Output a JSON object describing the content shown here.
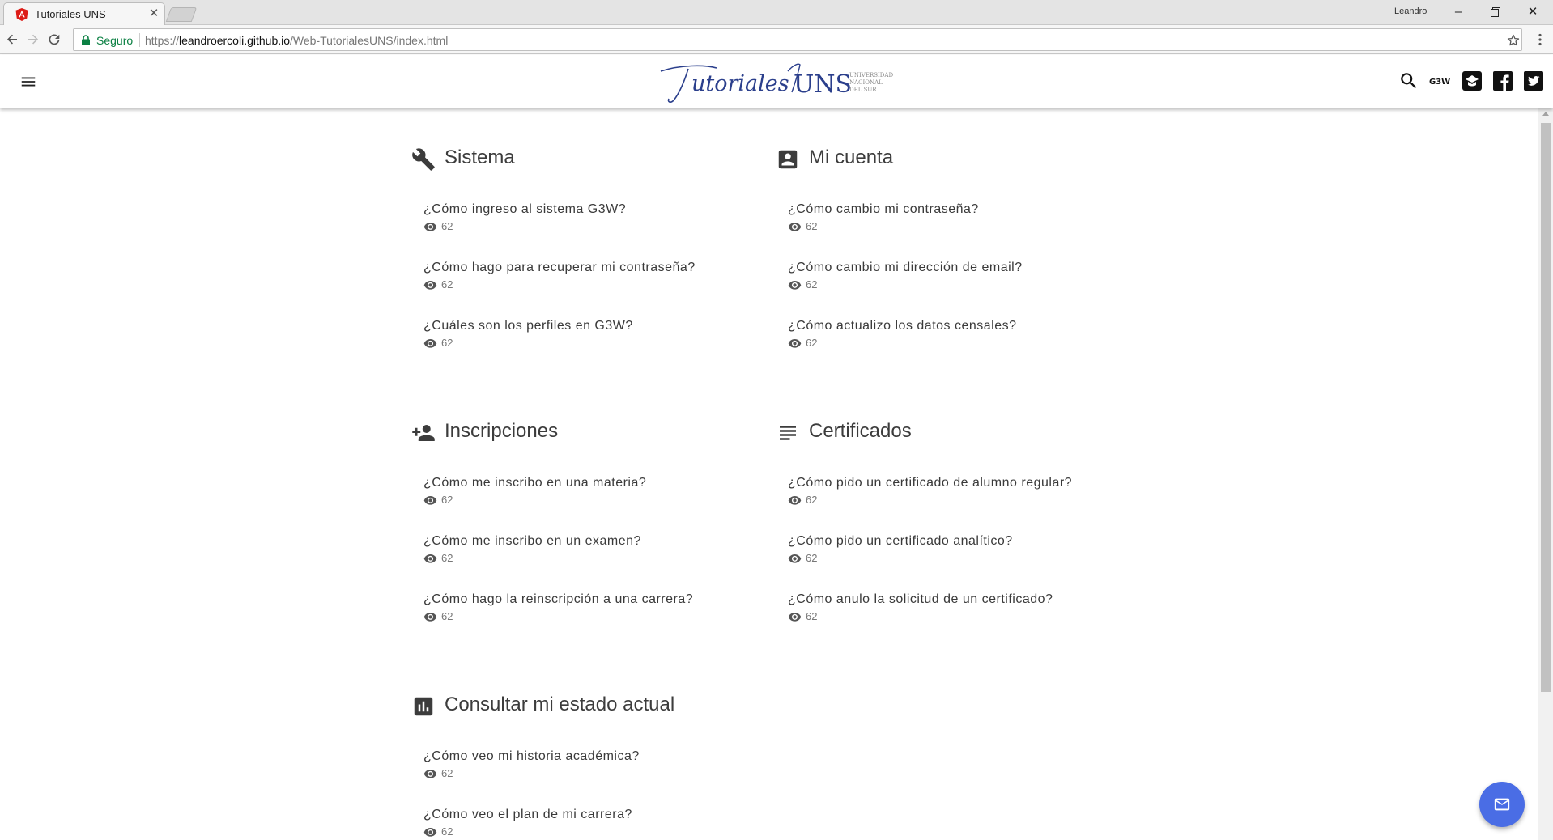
{
  "browser": {
    "tab_title": "Tutoriales UNS",
    "profile_name": "Leandro",
    "secure_label": "Seguro",
    "url_scheme": "https://",
    "url_host": "leandroercoli.github.io",
    "url_path": "/Web-TutorialesUNS/index.html"
  },
  "header": {
    "logo_text": "Tutoriales UNS",
    "logo_sub": "UNIVERSIDAD NACIONAL DEL SUR",
    "g3w_label": "G3W",
    "icons": [
      "menu-icon",
      "search-icon",
      "g3w-icon",
      "moodle-icon",
      "facebook-icon",
      "twitter-icon"
    ]
  },
  "sections": [
    {
      "title": "Sistema",
      "icon": "wrench-icon",
      "items": [
        {
          "question": "¿Cómo ingreso al sistema G3W?",
          "views": "62"
        },
        {
          "question": "¿Cómo hago para recuperar mi contraseña?",
          "views": "62"
        },
        {
          "question": "¿Cuáles son los perfiles en G3W?",
          "views": "62"
        }
      ]
    },
    {
      "title": "Mi cuenta",
      "icon": "account-box-icon",
      "items": [
        {
          "question": "¿Cómo cambio mi contraseña?",
          "views": "62"
        },
        {
          "question": "¿Cómo cambio mi dirección de email?",
          "views": "62"
        },
        {
          "question": "¿Cómo actualizo los datos censales?",
          "views": "62"
        }
      ]
    },
    {
      "title": "Inscripciones",
      "icon": "person-add-icon",
      "items": [
        {
          "question": "¿Cómo me inscribo en una materia?",
          "views": "62"
        },
        {
          "question": "¿Cómo me inscribo en un examen?",
          "views": "62"
        },
        {
          "question": "¿Cómo hago la reinscripción a una carrera?",
          "views": "62"
        }
      ]
    },
    {
      "title": "Certificados",
      "icon": "subject-icon",
      "items": [
        {
          "question": "¿Cómo pido un certificado de alumno regular?",
          "views": "62"
        },
        {
          "question": "¿Cómo pido un certificado analítico?",
          "views": "62"
        },
        {
          "question": "¿Cómo anulo la solicitud de un certificado?",
          "views": "62"
        }
      ]
    },
    {
      "title": "Consultar mi estado actual",
      "icon": "assessment-icon",
      "items": [
        {
          "question": "¿Cómo veo mi historia académica?",
          "views": "62"
        },
        {
          "question": "¿Cómo veo el plan de mi carrera?",
          "views": "62"
        }
      ]
    }
  ],
  "colors": {
    "fab": "#4a6de5",
    "secure": "#0b8043",
    "logo": "#2b3f8c"
  }
}
